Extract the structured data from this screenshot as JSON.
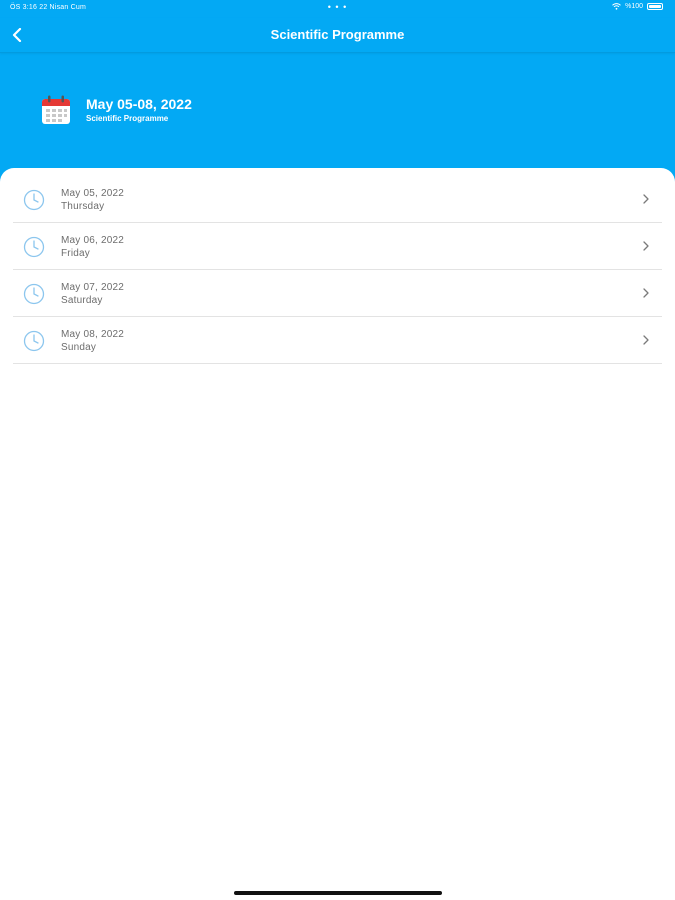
{
  "status_bar": {
    "time_date": "ÖS 3:16   22 Nisan Cum",
    "dots": "• • •",
    "battery": "%100"
  },
  "nav": {
    "title": "Scientific Programme",
    "back_icon": "chevron-left-icon"
  },
  "event": {
    "date_range": "May 05-08, 2022",
    "subtitle": "Scientific Programme",
    "icon": "calendar-icon"
  },
  "days": [
    {
      "date": "May 05, 2022",
      "weekday": "Thursday"
    },
    {
      "date": "May 06, 2022",
      "weekday": "Friday"
    },
    {
      "date": "May 07, 2022",
      "weekday": "Saturday"
    },
    {
      "date": "May 08, 2022",
      "weekday": "Sunday"
    }
  ],
  "colors": {
    "header_bg": "#03a9f4",
    "text_muted": "#6d6d6d",
    "icon_stroke": "#8cc6ee"
  }
}
